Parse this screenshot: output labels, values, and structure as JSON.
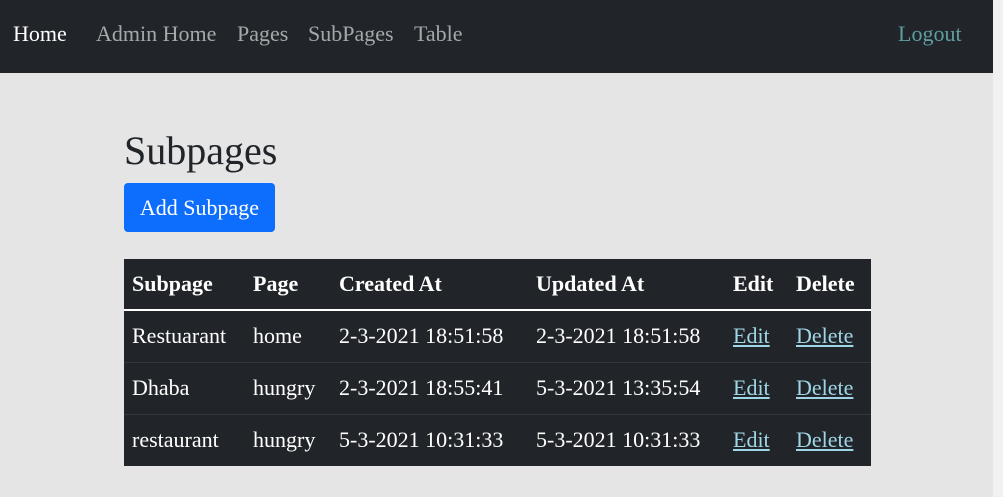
{
  "nav": {
    "home": "Home",
    "admin_home": "Admin Home",
    "pages": "Pages",
    "subpages": "SubPages",
    "table": "Table",
    "logout": "Logout"
  },
  "main": {
    "title": "Subpages",
    "add_button_label": "Add Subpage"
  },
  "table": {
    "headers": [
      "Subpage",
      "Page",
      "Created At",
      "Updated At",
      "Edit",
      "Delete"
    ],
    "rows": [
      {
        "subpage": "Restuarant",
        "page": "home",
        "created_at": "2-3-2021 18:51:58",
        "updated_at": "2-3-2021 18:51:58",
        "edit": "Edit",
        "delete": "Delete"
      },
      {
        "subpage": "Dhaba",
        "page": "hungry",
        "created_at": "2-3-2021 18:55:41",
        "updated_at": "5-3-2021 13:35:54",
        "edit": "Edit",
        "delete": "Delete"
      },
      {
        "subpage": "restaurant",
        "page": "hungry",
        "created_at": "5-3-2021 10:31:33",
        "updated_at": "5-3-2021 10:31:33",
        "edit": "Edit",
        "delete": "Delete"
      }
    ]
  },
  "colors": {
    "navbar_bg": "#212529",
    "page_bg": "#e5e5e5",
    "primary_button": "#0d6efd",
    "table_bg": "#212529",
    "link": "#9fd6e6",
    "logout": "#5f9ea0"
  }
}
